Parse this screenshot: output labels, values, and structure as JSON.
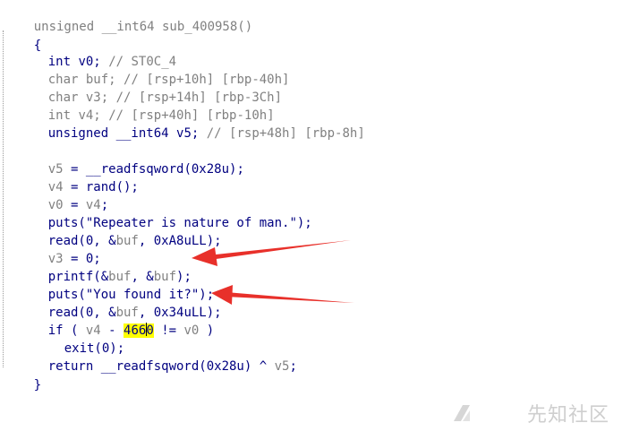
{
  "code": {
    "signature": "unsigned __int64 sub_400958()",
    "open_brace": "{",
    "close_brace": "}",
    "decls": [
      {
        "type": "int",
        "name": "v0;",
        "comment": "// ST0C_4"
      },
      {
        "type": "char",
        "name": "buf;",
        "comment": "// [rsp+10h] [rbp-40h]"
      },
      {
        "type": "char",
        "name": "v3;",
        "comment": "// [rsp+14h] [rbp-3Ch]"
      },
      {
        "type": "int",
        "name": "v4;",
        "comment": "// [rsp+40h] [rbp-10h]"
      },
      {
        "type": "unsigned __int64",
        "name": "v5;",
        "comment": "// [rsp+48h] [rbp-8h]"
      }
    ],
    "stmt_v5": {
      "lhs": "v5",
      "rhs": " = __readfsqword(0x28u);"
    },
    "stmt_v4": {
      "lhs": "v4",
      "rhs": " = rand();"
    },
    "stmt_v0": {
      "lhs": "v0",
      "mid": " = ",
      "rhs": "v4",
      "end": ";"
    },
    "stmt_puts1": "puts(\"Repeater is nature of man.\");",
    "stmt_read1": {
      "a": "read(0, &",
      "b": "buf",
      "c": ", 0xA8uLL);"
    },
    "stmt_v3": {
      "lhs": "v3",
      "rhs": " = 0;"
    },
    "stmt_printf": {
      "a": "printf(&",
      "b": "buf",
      "c": ", &",
      "d": "buf",
      "e": ");"
    },
    "stmt_puts2": "puts(\"You found it?\");",
    "stmt_read2": {
      "a": "read(0, &",
      "b": "buf",
      "c": ", 0x34uLL);"
    },
    "stmt_if": {
      "a": "if ( ",
      "b": "v4",
      "c": " - ",
      "hl1": "46",
      "hl2": "6",
      "hl3": "0",
      "d": " != ",
      "e": "v0",
      "f": " )"
    },
    "stmt_exit": "exit(0);",
    "stmt_return": {
      "a": "return __readfsqword(0x28u) ^ ",
      "b": "v5",
      "c": ";"
    }
  },
  "watermark": {
    "text": "先知社区"
  },
  "colors": {
    "code": "#000080",
    "comment": "#808080",
    "highlight": "#ffff00",
    "arrow": "#e8302a"
  }
}
